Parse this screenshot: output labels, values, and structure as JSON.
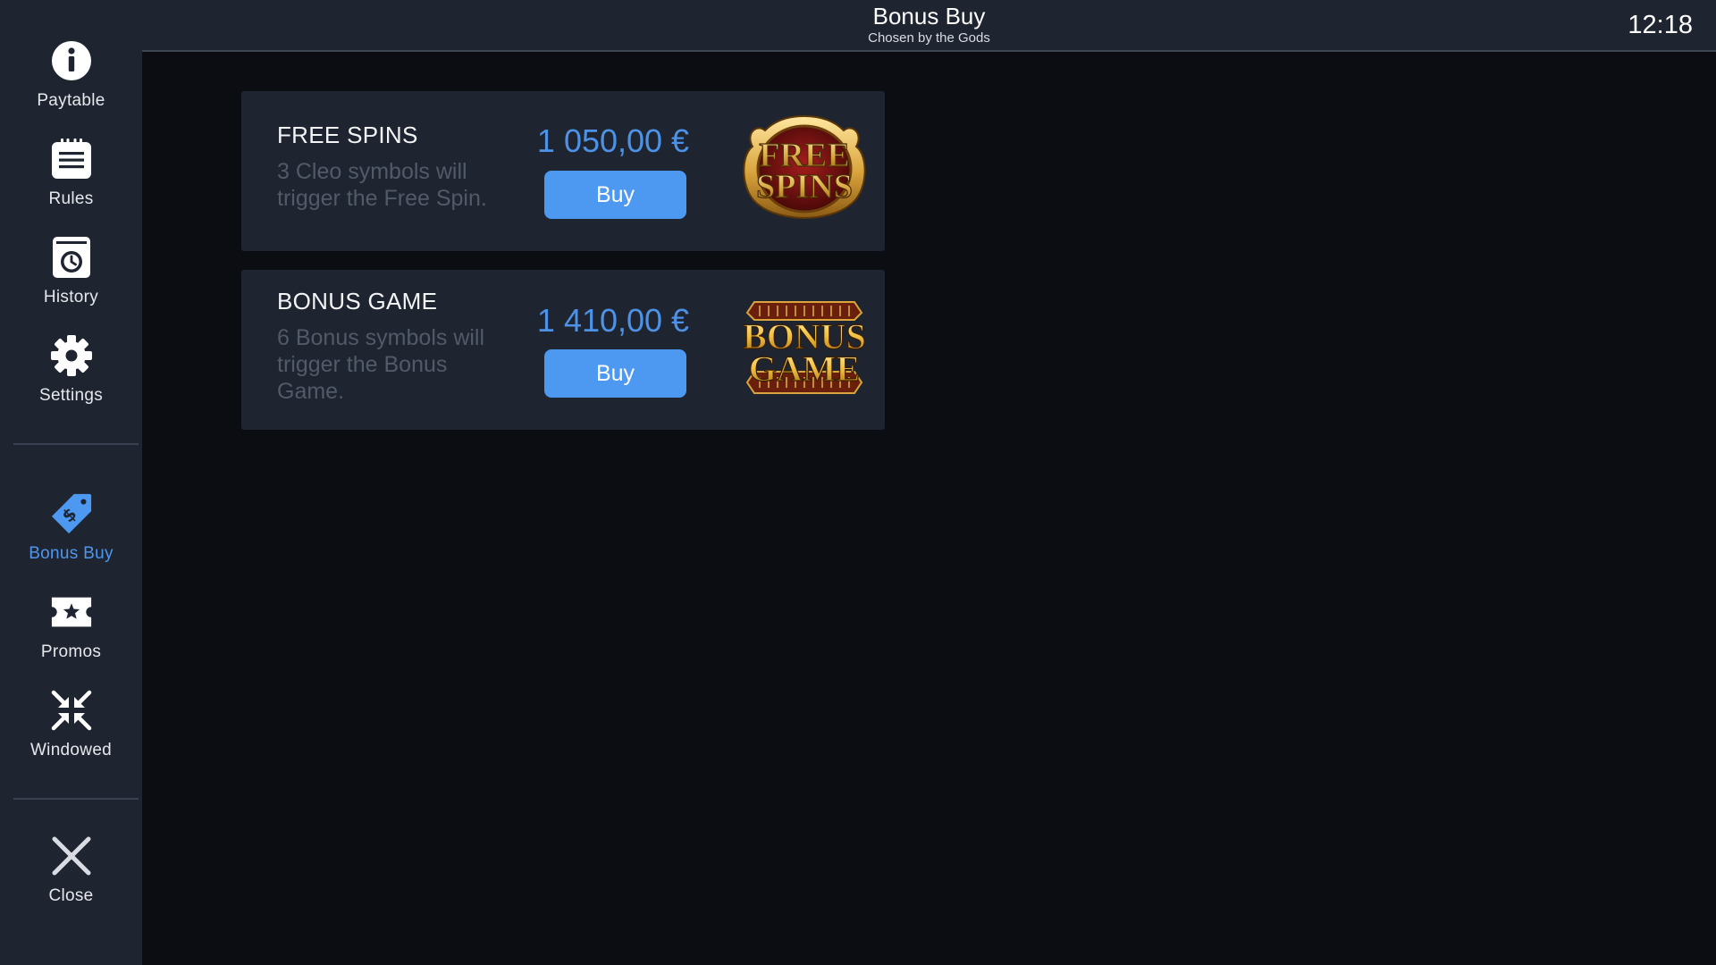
{
  "header": {
    "title": "Bonus Buy",
    "subtitle": "Chosen by the Gods",
    "clock": "12:18"
  },
  "sidebar": {
    "items": [
      {
        "label": "Paytable",
        "icon": "info-icon"
      },
      {
        "label": "Rules",
        "icon": "rules-list-icon"
      },
      {
        "label": "History",
        "icon": "history-clock-icon"
      },
      {
        "label": "Settings",
        "icon": "gear-icon"
      },
      {
        "label": "Bonus Buy",
        "icon": "price-tag-icon",
        "active": true
      },
      {
        "label": "Promos",
        "icon": "ticket-star-icon"
      },
      {
        "label": "Windowed",
        "icon": "collapse-arrows-icon"
      }
    ],
    "close": {
      "label": "Close",
      "icon": "close-icon"
    }
  },
  "offers": [
    {
      "title": "FREE SPINS",
      "description": "3 Cleo symbols will trigger the Free Spin.",
      "price": "1 050,00 €",
      "button": "Buy",
      "logo_line1": "FREE",
      "logo_line2": "SPINS"
    },
    {
      "title": "BONUS GAME",
      "description": "6 Bonus symbols will trigger the Bonus Game.",
      "price": "1 410,00 €",
      "button": "Buy",
      "logo_line1": "BONUS",
      "logo_line2": "GAME"
    }
  ],
  "colors": {
    "panel": "#1e2430",
    "background": "#0b0d12",
    "accent": "#4d98f0",
    "price": "#4d92e6",
    "muted_text": "#525a68"
  }
}
